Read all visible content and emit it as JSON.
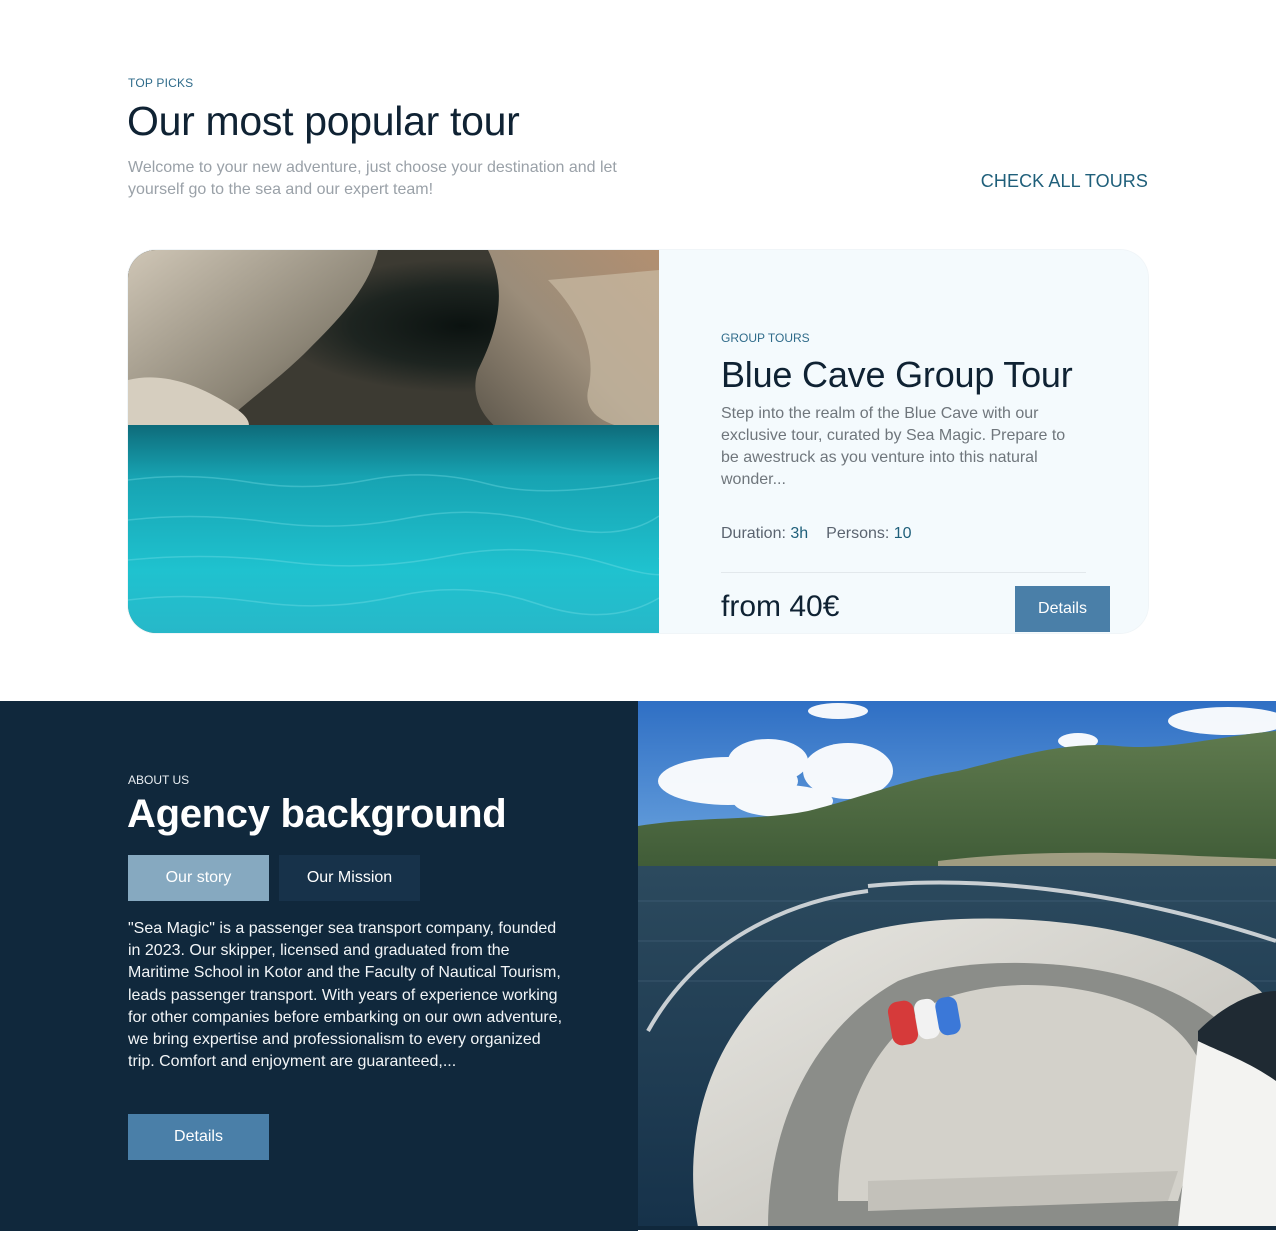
{
  "popular": {
    "eyebrow": "TOP PICKS",
    "title": "Our most popular tour",
    "subtitle": "Welcome to your new adventure, just choose your destination and let yourself go to the sea and our expert team!",
    "check_all_label": "CHECK ALL TOURS"
  },
  "tour": {
    "eyebrow": "GROUP TOURS",
    "title": "Blue Cave Group Tour",
    "description": "Step into the realm of the Blue Cave with our exclusive tour, curated by Sea Magic. Prepare to be awestruck as you venture into this natural wonder...",
    "duration_label": "Duration:",
    "duration_value": "3h",
    "persons_label": "Persons:",
    "persons_value": "10",
    "price": "from 40€",
    "details_label": "Details"
  },
  "about": {
    "eyebrow": "ABOUT US",
    "title": "Agency background",
    "tabs": [
      {
        "label": "Our story",
        "active": true
      },
      {
        "label": "Our Mission",
        "active": false
      }
    ],
    "text": "\"Sea Magic\" is a passenger sea transport company, founded in 2023. Our skipper, licensed and graduated from the Maritime School in Kotor and the Faculty of Nautical Tourism, leads passenger transport. With years of experience working for other companies before embarking on our own adventure, we bring expertise and professionalism to every organized trip. Comfort and enjoyment are guaranteed,...",
    "details_label": "Details"
  },
  "colors": {
    "navy": "#10283c",
    "accent_button": "#4a7fa8",
    "active_tab": "#86a9c0",
    "link": "#1f5f7a"
  }
}
